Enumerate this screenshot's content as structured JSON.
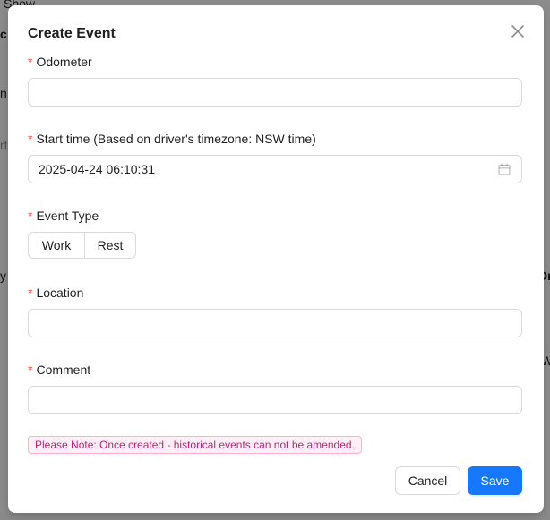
{
  "background": {
    "fragments": [
      "Show",
      "c",
      "n",
      "rt",
      "y",
      "Dr",
      "W"
    ]
  },
  "modal": {
    "title": "Create Event",
    "close_icon": "close-icon",
    "fields": {
      "odometer": {
        "label": "Odometer",
        "value": "",
        "required": true
      },
      "start_time": {
        "label": "Start time (Based on driver's timezone: NSW time)",
        "value": "2025-04-24 06:10:31",
        "required": true,
        "icon": "calendar-icon"
      },
      "event_type": {
        "label": "Event Type",
        "required": true,
        "options": [
          "Work",
          "Rest"
        ]
      },
      "location": {
        "label": "Location",
        "value": "",
        "required": true
      },
      "comment": {
        "label": "Comment",
        "value": "",
        "required": true
      }
    },
    "required_marker": "*",
    "note": "Please Note: Once created - historical events can not be amended.",
    "buttons": {
      "cancel": "Cancel",
      "save": "Save"
    }
  },
  "colors": {
    "primary": "#1677ff",
    "required": "#ff4d4f",
    "note_text": "#c41d7f",
    "note_bg": "#fff0f6",
    "note_border": "#ffadd2"
  }
}
